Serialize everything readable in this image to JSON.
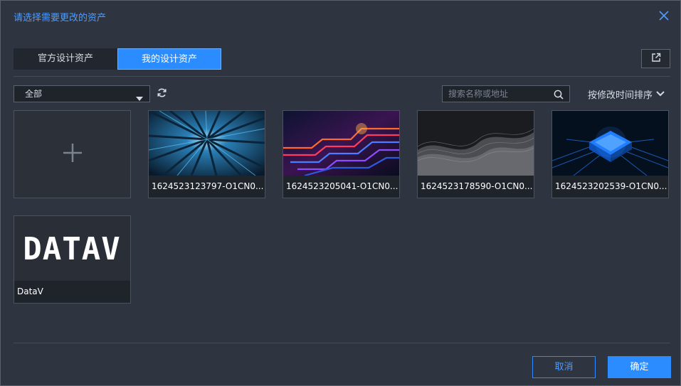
{
  "dialog": {
    "title": "请选择需要更改的资产"
  },
  "tabs": [
    {
      "label": "官方设计资产",
      "active": false
    },
    {
      "label": "我的设计资产",
      "active": true
    }
  ],
  "filter": {
    "selected": "全部"
  },
  "search": {
    "placeholder": "搜索名称或地址"
  },
  "sort": {
    "label": "按修改时间排序"
  },
  "assets": [
    {
      "name": "1624523123797-O1CN0..."
    },
    {
      "name": "1624523205041-O1CN0..."
    },
    {
      "name": "1624523178590-O1CN0..."
    },
    {
      "name": "1624523202539-O1CN0..."
    },
    {
      "name": "DataV",
      "logo_text": "DATAV"
    }
  ],
  "footer": {
    "cancel_label": "取消",
    "ok_label": "确定"
  },
  "colors": {
    "accent": "#2a8cff",
    "background": "#2f3540",
    "title": "#4d9bff"
  }
}
